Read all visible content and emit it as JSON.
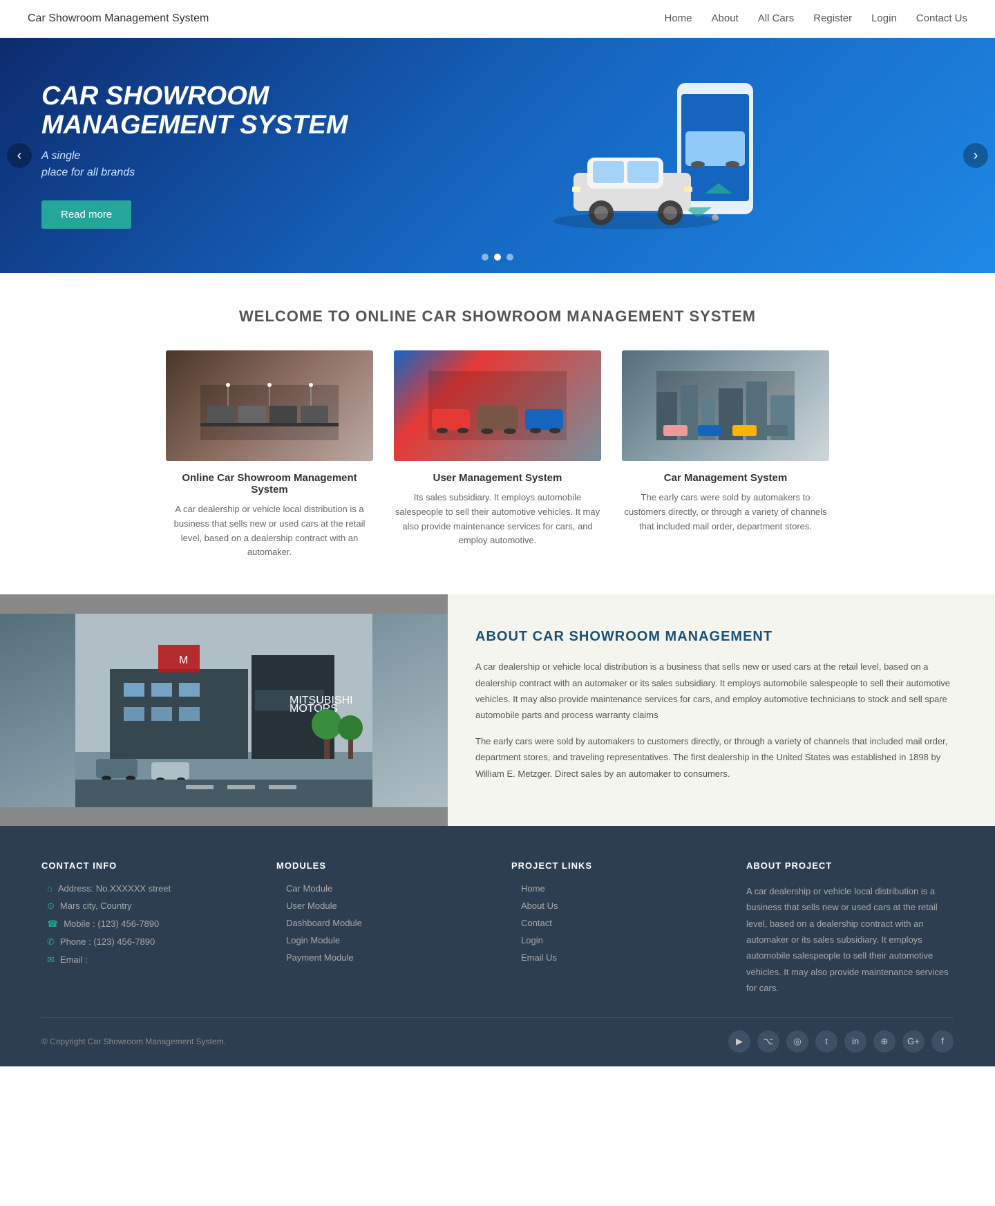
{
  "brand": {
    "name": "Car Showroom Management System"
  },
  "nav": {
    "links": [
      {
        "label": "Home",
        "href": "#"
      },
      {
        "label": "About",
        "href": "#"
      },
      {
        "label": "All Cars",
        "href": "#"
      },
      {
        "label": "Register",
        "href": "#"
      },
      {
        "label": "Login",
        "href": "#"
      },
      {
        "label": "Contact Us",
        "href": "#"
      }
    ]
  },
  "hero": {
    "title": "CAR SHOWROOM MANAGEMENT SYSTEM",
    "subtitle_line1": "A single",
    "subtitle_line2": "place for all brands",
    "btn_label": "Read more",
    "dots": [
      1,
      2,
      3
    ],
    "active_dot": 1
  },
  "welcome": {
    "title": "WELCOME TO ONLINE CAR SHOWROOM MANAGEMENT SYSTEM",
    "cards": [
      {
        "id": "card1",
        "title": "Online Car Showroom Management System",
        "desc": "A car dealership or vehicle local distribution is a business that sells new or used cars at the retail level, based on a dealership contract with an automaker."
      },
      {
        "id": "card2",
        "title": "User Management System",
        "desc": "Its sales subsidiary. It employs automobile salespeople to sell their automotive vehicles. It may also provide maintenance services for cars, and employ automotive."
      },
      {
        "id": "card3",
        "title": "Car Management System",
        "desc": "The early cars were sold by automakers to customers directly, or through a variety of channels that included mail order, department stores."
      }
    ]
  },
  "about": {
    "title": "ABOUT CAR SHOWROOM MANAGEMENT",
    "para1": "A car dealership or vehicle local distribution is a business that sells new or used cars at the retail level, based on a dealership contract with an automaker or its sales subsidiary. It employs automobile salespeople to sell their automotive vehicles. It may also provide maintenance services for cars, and employ automotive technicians to stock and sell spare automobile parts and process warranty claims",
    "para2": "The early cars were sold by automakers to customers directly, or through a variety of channels that included mail order, department stores, and traveling representatives. The first dealership in the United States was established in 1898 by William E. Metzger. Direct sales by an automaker to consumers."
  },
  "footer": {
    "contact": {
      "title": "CONTACT INFO",
      "items": [
        {
          "icon": "house",
          "text": "Address: No.XXXXXX street"
        },
        {
          "icon": "map",
          "text": "Mars city, Country"
        },
        {
          "icon": "mobile",
          "text": "Mobile : (123) 456-7890"
        },
        {
          "icon": "phone",
          "text": "Phone : (123) 456-7890"
        },
        {
          "icon": "email",
          "text": "Email :"
        }
      ]
    },
    "modules": {
      "title": "MODULES",
      "items": [
        {
          "label": "Car Module"
        },
        {
          "label": "User Module"
        },
        {
          "label": "Dashboard Module"
        },
        {
          "label": "Login Module"
        },
        {
          "label": "Payment Module"
        }
      ]
    },
    "project_links": {
      "title": "PROJECT LINKS",
      "items": [
        {
          "label": "Home"
        },
        {
          "label": "About Us"
        },
        {
          "label": "Contact"
        },
        {
          "label": "Login"
        },
        {
          "label": "Email Us"
        }
      ]
    },
    "about_project": {
      "title": "ABOUT PROJECT",
      "text": "A car dealership or vehicle local distribution is a business that sells new or used cars at the retail level, based on a dealership contract with an automaker or its sales subsidiary. It employs automobile salespeople to sell their automotive vehicles. It may also provide maintenance services for cars."
    },
    "copyright": "© Copyright Car Showroom Management System.",
    "social": [
      {
        "icon": "▶",
        "name": "youtube"
      },
      {
        "icon": "⌥",
        "name": "github"
      },
      {
        "icon": "◎",
        "name": "skype"
      },
      {
        "icon": "𝕥",
        "name": "twitter"
      },
      {
        "icon": "in",
        "name": "linkedin"
      },
      {
        "icon": "⊕",
        "name": "dribbble"
      },
      {
        "icon": "G+",
        "name": "googleplus"
      },
      {
        "icon": "f",
        "name": "facebook"
      }
    ]
  }
}
